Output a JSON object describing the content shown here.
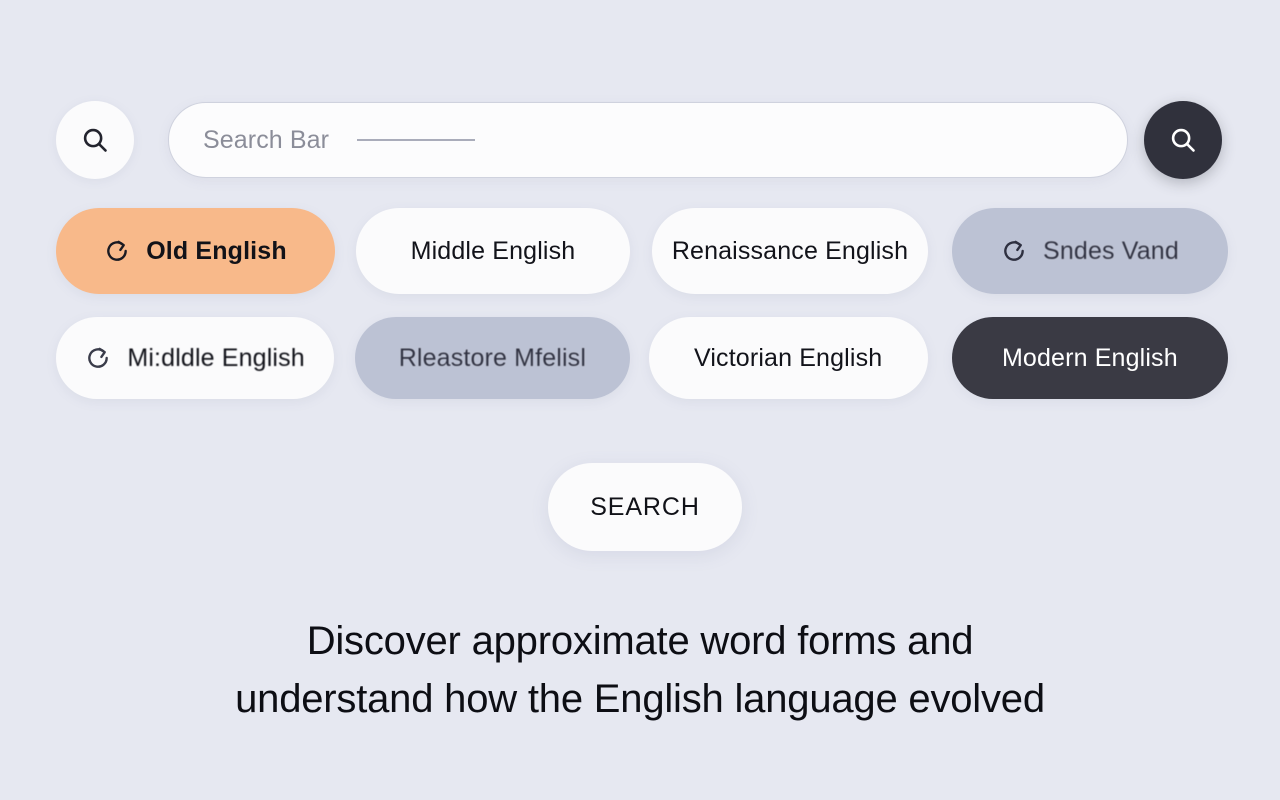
{
  "page": {
    "background_color": "#e6e8f1"
  },
  "search": {
    "left_icon": "search-icon",
    "placeholder": "Search Bar",
    "value": "",
    "submit_icon": "search-icon"
  },
  "chips": {
    "row1": [
      {
        "label": "Old English",
        "style": "peach",
        "icon": "refresh-icon",
        "garbled": false
      },
      {
        "label": "Middle English",
        "style": "white",
        "icon": null,
        "garbled": false
      },
      {
        "label": "Renaissance English",
        "style": "white",
        "icon": null,
        "garbled": false
      },
      {
        "label": "Sndes Vand",
        "style": "grey",
        "icon": "refresh-icon",
        "garbled": true
      }
    ],
    "row2": [
      {
        "label": "Mi:dldle English",
        "style": "white",
        "icon": "refresh-icon",
        "garbled": true
      },
      {
        "label": "Rleastore Mfelisl",
        "style": "grey",
        "icon": null,
        "garbled": true
      },
      {
        "label": "Victorian English",
        "style": "white",
        "icon": null,
        "garbled": false
      },
      {
        "label": "Modern English",
        "style": "dark",
        "icon": null,
        "garbled": false
      }
    ]
  },
  "cta": {
    "label": "SEARCH"
  },
  "tagline": {
    "line1": "Discover approximate word forms and",
    "line2": "understand how the English language evolved"
  },
  "colors": {
    "background": "#e6e8f1",
    "chip_peach": "#f8b98a",
    "chip_grey": "#bcc2d4",
    "chip_dark": "#3a3a44",
    "chip_white": "#fbfbfc",
    "dark_button": "#30313c",
    "placeholder_text": "#8b8d99",
    "body_text": "#0d0e14"
  }
}
